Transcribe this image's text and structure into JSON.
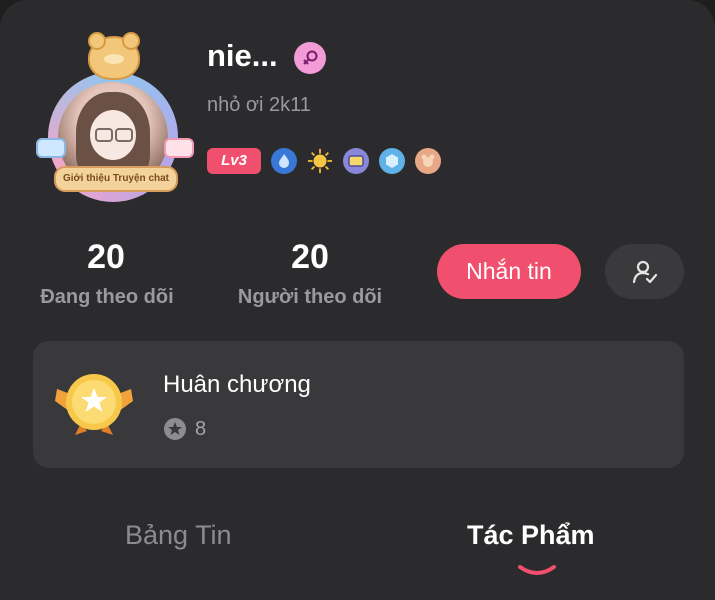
{
  "profile": {
    "name": "nie...",
    "subtitle": "nhỏ ơi 2k11",
    "avatar_label": "Giới thiệu Truyện chat",
    "level": "Lv3",
    "gender_icon": "female-icon"
  },
  "stats": {
    "following_count": "20",
    "following_label": "Đang theo dõi",
    "followers_count": "20",
    "followers_label": "Người theo dõi"
  },
  "actions": {
    "message_label": "Nhắn tin",
    "follow_icon": "user-check-icon"
  },
  "medals": {
    "title": "Huân chương",
    "count": "8"
  },
  "tabs": [
    {
      "label": "Bảng Tin",
      "active": false
    },
    {
      "label": "Tác Phẩm",
      "active": true
    }
  ],
  "colors": {
    "background": "#2b2b2d",
    "accent": "#f0506e",
    "card": "#39393b"
  }
}
